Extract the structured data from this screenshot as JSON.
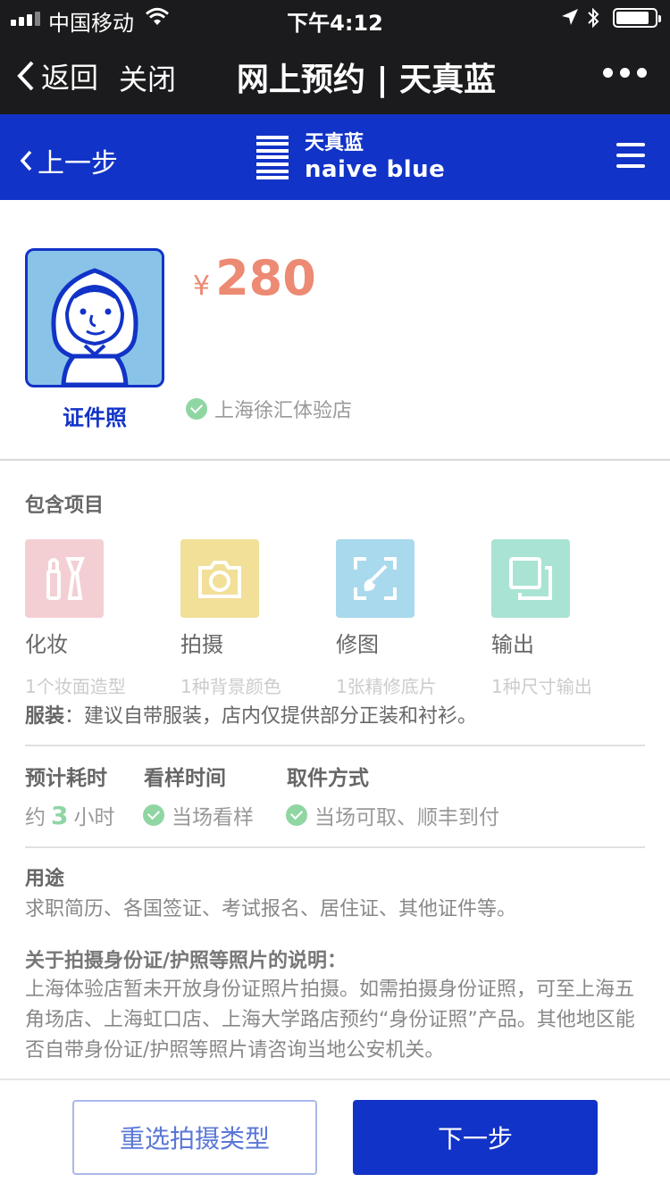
{
  "status_bar": {
    "carrier": "中国移动",
    "time": "下午4:12"
  },
  "wechat_nav": {
    "back_label": "返回",
    "close_label": "关闭",
    "title": "网上预约 | 天真蓝"
  },
  "brand": {
    "prev_label": "上一步",
    "logo_cn": "天真蓝",
    "logo_en": "naive blue",
    "accent_color": "#1233c7"
  },
  "product": {
    "type_label": "证件照",
    "currency": "¥",
    "price": "280",
    "store": "上海徐汇体验店",
    "price_color": "#ec8a73"
  },
  "includes": {
    "title": "包含项目",
    "items": [
      {
        "icon": "makeup-icon",
        "name": "化妆",
        "desc": "1个妆面造型",
        "color": "#f3cfd4"
      },
      {
        "icon": "camera-icon",
        "name": "拍摄",
        "desc": "1种背景颜色",
        "color": "#f2df98"
      },
      {
        "icon": "retouch-icon",
        "name": "修图",
        "desc": "1张精修底片",
        "color": "#a9d9ec"
      },
      {
        "icon": "output-icon",
        "name": "输出",
        "desc": "1种尺寸输出",
        "color": "#a9e3d3"
      }
    ],
    "clothing_label": "服装",
    "clothing_text": "：建议自带服装，店内仅提供部分正装和衬衫。"
  },
  "details": {
    "time_head": "预计耗时",
    "time_prefix": "约",
    "time_value": "3",
    "time_suffix": "小时",
    "preview_head": "看样时间",
    "preview_value": "当场看样",
    "pickup_head": "取件方式",
    "pickup_value": "当场可取、顺丰到付"
  },
  "usage": {
    "title": "用途",
    "text": "求职简历、各国签证、考试报名、居住证、其他证件等。"
  },
  "note": {
    "title": "关于拍摄身份证/护照等照片的说明：",
    "text": "上海体验店暂未开放身份证照片拍摄。如需拍摄身份证照，可至上海五角场店、上海虹口店、上海大学路店预约“身份证照”产品。其他地区能否自带身份证/护照等照片请咨询当地公安机关。"
  },
  "actions": {
    "reselect_label": "重选拍摄类型",
    "next_label": "下一步"
  }
}
